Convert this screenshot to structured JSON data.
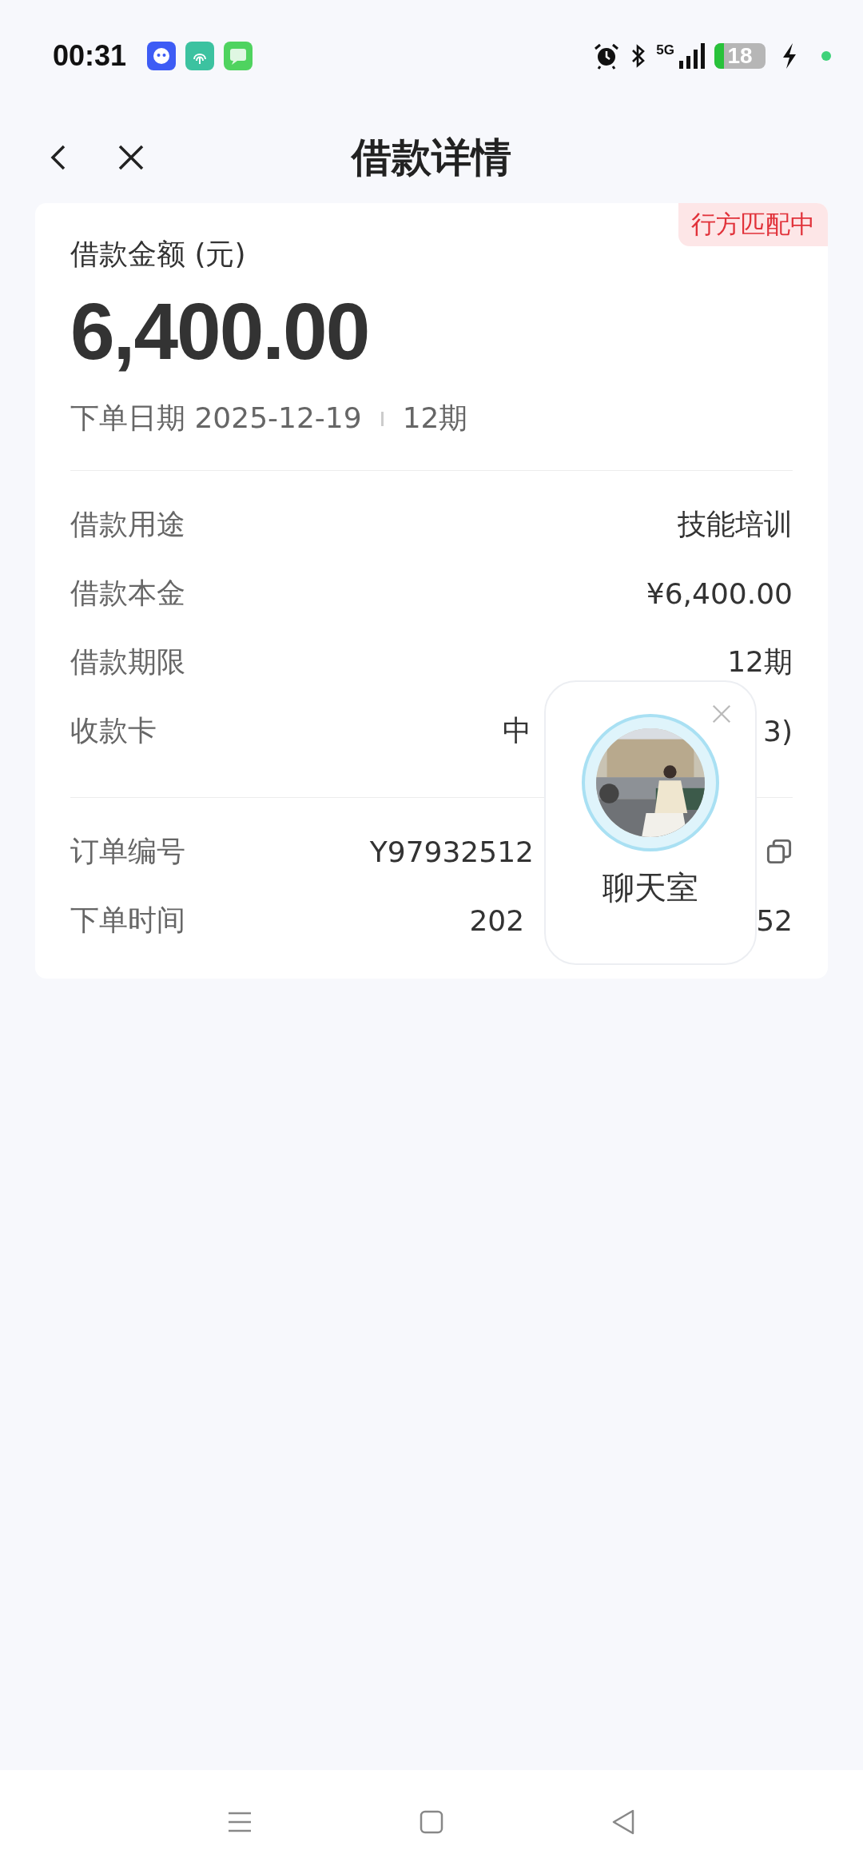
{
  "status_bar": {
    "time": "00:31",
    "network": "5G",
    "battery": "18"
  },
  "header": {
    "title": "借款详情"
  },
  "card": {
    "badge": "行方匹配中",
    "amount_label": "借款金额 (元)",
    "amount": "6,400.00",
    "date": "下单日期 2025-12-19",
    "term": "12期",
    "rows": [
      {
        "label": "借款用途",
        "value_start": "技能培训"
      },
      {
        "label": "借款本金",
        "value_start": "¥6,400.00"
      },
      {
        "label": "借款期限",
        "value_start": "12期"
      },
      {
        "label": "收款卡",
        "value_start": "中",
        "value_end": "3)"
      }
    ],
    "rows2": [
      {
        "label": "订单编号",
        "value_start": "Y97932512",
        "copy": true
      },
      {
        "label": "下单时间",
        "value_start": "202",
        "value_end": "52"
      }
    ]
  },
  "chat_popup": {
    "label": "聊天室"
  }
}
